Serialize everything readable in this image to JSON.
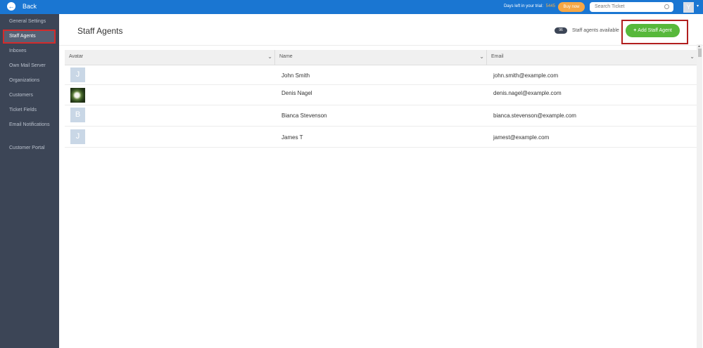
{
  "topbar": {
    "back_label": "Back",
    "trial_text": "Days left in your trial:",
    "trial_days": "5445",
    "buy_label": "Buy now",
    "search_placeholder": "Search Ticket",
    "user_initial": "Y"
  },
  "sidebar": {
    "items": [
      {
        "label": "General Settings"
      },
      {
        "label": "Staff Agents"
      },
      {
        "label": "Inboxes"
      },
      {
        "label": "Own Mail Server"
      },
      {
        "label": "Organizations"
      },
      {
        "label": "Customers"
      },
      {
        "label": "Ticket Fields"
      },
      {
        "label": "Email Notifications"
      },
      {
        "label": "Customer Portal"
      }
    ]
  },
  "page": {
    "title": "Staff Agents",
    "available_count": "96",
    "available_label": "Staff agents available",
    "add_button_label": "Add Staff Agent"
  },
  "table": {
    "columns": [
      "Avatar",
      "Name",
      "Email"
    ],
    "rows": [
      {
        "initial": "J",
        "name": "John Smith",
        "email": "john.smith@example.com"
      },
      {
        "initial": "",
        "name": "Denis Nagel",
        "email": "denis.nagel@example.com"
      },
      {
        "initial": "B",
        "name": "Bianca Stevenson",
        "email": "bianca.stevenson@example.com"
      },
      {
        "initial": "J",
        "name": "James T",
        "email": "jamest@example.com"
      }
    ]
  },
  "colors": {
    "topbar": "#1a76d2",
    "sidebar": "#3c4556",
    "add_button": "#57b83b",
    "buy_button": "#f7a745",
    "highlight": "#d32b2b"
  }
}
